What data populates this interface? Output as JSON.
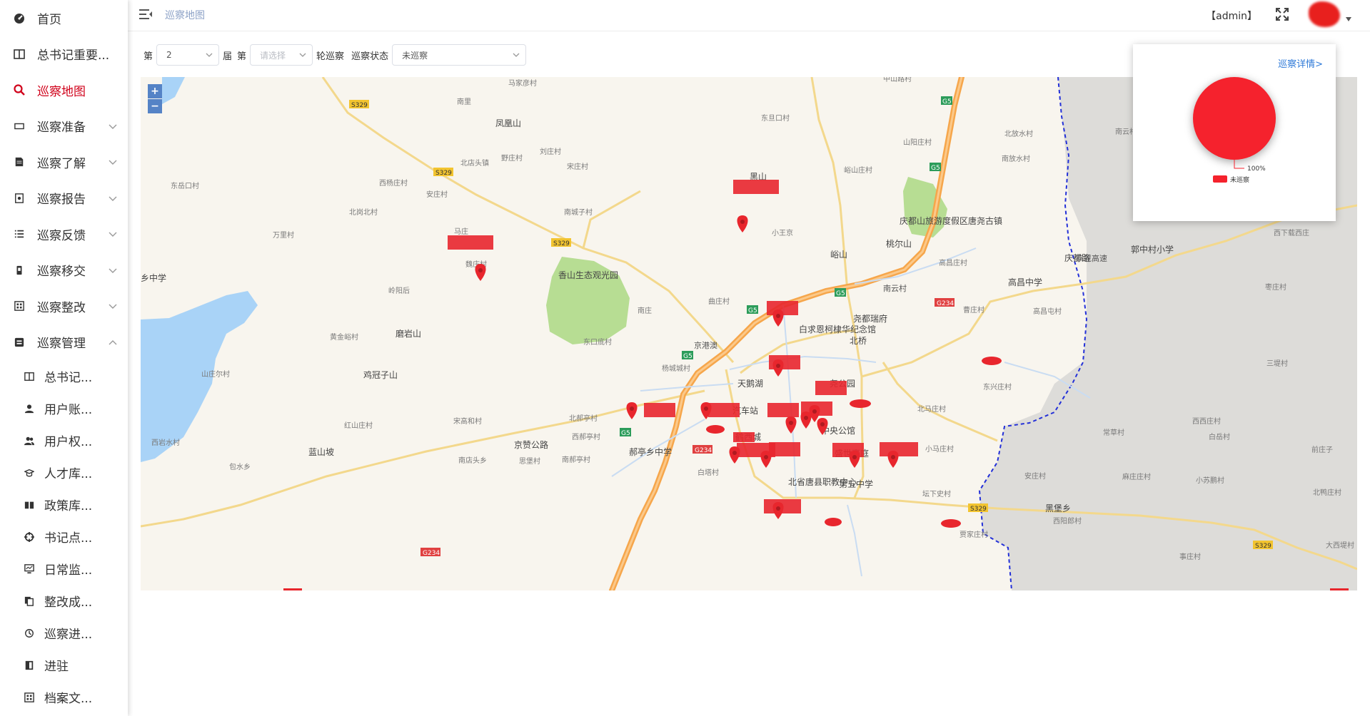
{
  "sidebar": {
    "items": [
      {
        "label": "首页",
        "icon": "dashboard-icon",
        "expandable": false,
        "active": false
      },
      {
        "label": "总书记重要...",
        "icon": "columns-icon",
        "expandable": false,
        "active": false
      },
      {
        "label": "巡察地图",
        "icon": "search-icon",
        "expandable": false,
        "active": true
      },
      {
        "label": "巡察准备",
        "icon": "card-icon",
        "expandable": true,
        "active": false
      },
      {
        "label": "巡察了解",
        "icon": "document-icon",
        "expandable": true,
        "active": false
      },
      {
        "label": "巡察报告",
        "icon": "report-icon",
        "expandable": true,
        "active": false
      },
      {
        "label": "巡察反馈",
        "icon": "list-icon",
        "expandable": true,
        "active": false
      },
      {
        "label": "巡察移交",
        "icon": "transfer-icon",
        "expandable": true,
        "active": false
      },
      {
        "label": "巡察整改",
        "icon": "calculator-icon",
        "expandable": true,
        "active": false
      },
      {
        "label": "巡察管理",
        "icon": "manage-icon",
        "expandable": true,
        "active": false,
        "expanded": true
      }
    ],
    "sub_items": [
      {
        "label": "总书记...",
        "icon": "columns-icon"
      },
      {
        "label": "用户账...",
        "icon": "user-icon"
      },
      {
        "label": "用户权...",
        "icon": "users-icon"
      },
      {
        "label": "人才库...",
        "icon": "graduation-icon"
      },
      {
        "label": "政策库...",
        "icon": "book-icon"
      },
      {
        "label": "书记点...",
        "icon": "crosshair-icon"
      },
      {
        "label": "日常监...",
        "icon": "monitor-icon"
      },
      {
        "label": "整改成...",
        "icon": "copy-icon"
      },
      {
        "label": "巡察进...",
        "icon": "history-icon"
      },
      {
        "label": "进驻",
        "icon": "door-icon"
      },
      {
        "label": "档案文...",
        "icon": "archive-icon"
      }
    ]
  },
  "header": {
    "breadcrumb": "巡察地图",
    "user": "【admin】"
  },
  "filters": {
    "label_di": "第",
    "session_value": "2",
    "label_jie": "届",
    "label_di2": "第",
    "round_placeholder": "请选择",
    "label_lun": "轮巡察",
    "label_status": "巡察状态",
    "status_value": "未巡察"
  },
  "map": {
    "zoom_in": "+",
    "zoom_out": "−",
    "labels": [
      {
        "text": "马家彦村"
      },
      {
        "text": "南里"
      },
      {
        "text": "凤凰山"
      },
      {
        "text": "S329"
      },
      {
        "text": "S329"
      },
      {
        "text": "北店头镇"
      },
      {
        "text": "野庄村"
      },
      {
        "text": "刘庄村"
      },
      {
        "text": "宋庄村"
      },
      {
        "text": "西杨庄村"
      },
      {
        "text": "安庄村"
      },
      {
        "text": "东岳口村"
      },
      {
        "text": "北岗北村"
      },
      {
        "text": "S329"
      },
      {
        "text": "南城子村"
      },
      {
        "text": "万里村"
      },
      {
        "text": "马庄"
      },
      {
        "text": "魏庄村"
      },
      {
        "text": "香山生态观光园"
      },
      {
        "text": "乡中学"
      },
      {
        "text": "岭阳后"
      },
      {
        "text": "南庄"
      },
      {
        "text": "黄金峪村"
      },
      {
        "text": "磨岩山"
      },
      {
        "text": "东口底村"
      },
      {
        "text": "鸡冠子山"
      },
      {
        "text": "山庄尔村"
      },
      {
        "text": "杨城城村"
      },
      {
        "text": "北郝亭村"
      },
      {
        "text": "宋高和村"
      },
      {
        "text": "红山庄村"
      },
      {
        "text": "西郝亭村"
      },
      {
        "text": "西岩水村"
      },
      {
        "text": "蓝山坡"
      },
      {
        "text": "包水乡"
      },
      {
        "text": "G234"
      },
      {
        "text": "南店头乡"
      },
      {
        "text": "思堡村"
      },
      {
        "text": "南郝亭村"
      },
      {
        "text": "京赞公路"
      },
      {
        "text": "郝亭乡中学"
      },
      {
        "text": "白塔村"
      },
      {
        "text": "黑山"
      },
      {
        "text": "东旦口村"
      },
      {
        "text": "中山路村"
      },
      {
        "text": "山阳庄村"
      },
      {
        "text": "北放水村"
      },
      {
        "text": "南放水村"
      },
      {
        "text": "峪山庄村"
      },
      {
        "text": "庆都山旅游度假区唐尧古镇"
      },
      {
        "text": "小王京"
      },
      {
        "text": "峪山"
      },
      {
        "text": "桃尔山"
      },
      {
        "text": "高昌庄村"
      },
      {
        "text": "高昌中学"
      },
      {
        "text": "曲庄村"
      },
      {
        "text": "白求恩柯棣华纪念馆"
      },
      {
        "text": "尧都瑞府"
      },
      {
        "text": "北桥"
      },
      {
        "text": "曹庄村"
      },
      {
        "text": "高昌屯村"
      },
      {
        "text": "天鹅湖"
      },
      {
        "text": "尧公园"
      },
      {
        "text": "汽车站"
      },
      {
        "text": "中央公馆"
      },
      {
        "text": "北马庄村"
      },
      {
        "text": "鹤西城"
      },
      {
        "text": "盛世豪庭"
      },
      {
        "text": "小马庄村"
      },
      {
        "text": "北省唐县职教中心"
      },
      {
        "text": "第五中学"
      },
      {
        "text": "坛下史村"
      },
      {
        "text": "贾家庄村"
      },
      {
        "text": "G5"
      },
      {
        "text": "G5"
      },
      {
        "text": "G5"
      },
      {
        "text": "G5"
      },
      {
        "text": "G5"
      },
      {
        "text": "G5"
      },
      {
        "text": "G234"
      },
      {
        "text": "G234"
      },
      {
        "text": "庆都路"
      },
      {
        "text": "京昆高速"
      },
      {
        "text": "京港澳"
      },
      {
        "text": "南云村"
      },
      {
        "text": "郭中村小学"
      },
      {
        "text": "西下载西庄"
      },
      {
        "text": "枣庄村"
      },
      {
        "text": "三堤村"
      },
      {
        "text": "东兴庄村"
      },
      {
        "text": "常草村"
      },
      {
        "text": "西西庄村"
      },
      {
        "text": "白岳村"
      },
      {
        "text": "前庄子"
      },
      {
        "text": "安庄村"
      },
      {
        "text": "麻庄庄村"
      },
      {
        "text": "小苏鹏村"
      },
      {
        "text": "北鸭庄村"
      },
      {
        "text": "黑堡乡"
      },
      {
        "text": "西阳郎村"
      },
      {
        "text": "S329"
      },
      {
        "text": "大西堤村"
      },
      {
        "text": "事庄村"
      }
    ]
  },
  "panel": {
    "detail_link": "巡察详情>",
    "chart_data": {
      "type": "pie",
      "categories": [
        "未巡察"
      ],
      "values": [
        100
      ],
      "data_labels": [
        "100%"
      ],
      "legend": [
        "未巡察"
      ],
      "legend_position": "bottom",
      "colors": [
        "#f5222d"
      ]
    }
  },
  "colors": {
    "accent_red": "#d0021b",
    "marker_red": "#e8262d",
    "highway_orange": "#f6a64b",
    "park_green": "#b7dd93",
    "water_blue": "#a9d3f7",
    "gray_region": "#dcdcdc"
  }
}
